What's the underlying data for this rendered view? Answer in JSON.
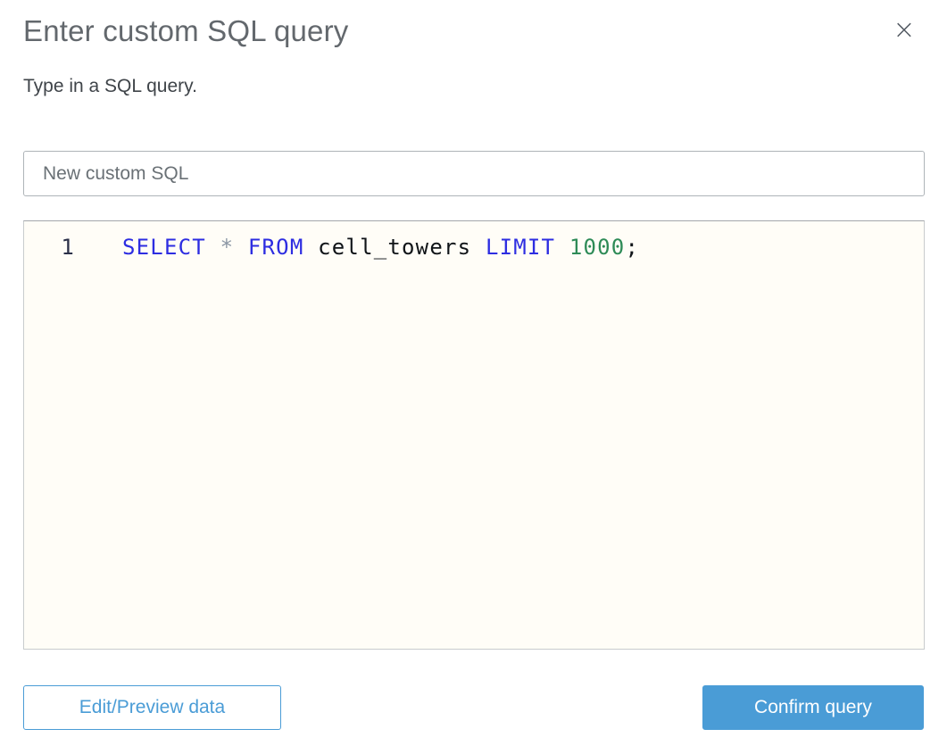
{
  "dialog": {
    "title": "Enter custom SQL query",
    "subtitle": "Type in a SQL query.",
    "close_icon": "×"
  },
  "name_input": {
    "value": "New custom SQL"
  },
  "editor": {
    "lines": [
      {
        "number": "1",
        "raw": "SELECT * FROM cell_towers LIMIT 1000;",
        "tokens": [
          {
            "text": "SELECT",
            "type": "keyword"
          },
          {
            "text": " ",
            "type": "plain"
          },
          {
            "text": "*",
            "type": "operator"
          },
          {
            "text": " ",
            "type": "plain"
          },
          {
            "text": "FROM",
            "type": "keyword"
          },
          {
            "text": " cell_towers ",
            "type": "plain"
          },
          {
            "text": "LIMIT",
            "type": "keyword"
          },
          {
            "text": " ",
            "type": "plain"
          },
          {
            "text": "1000",
            "type": "number"
          },
          {
            "text": ";",
            "type": "plain"
          }
        ]
      }
    ]
  },
  "footer": {
    "edit_preview_label": "Edit/Preview data",
    "confirm_label": "Confirm query"
  },
  "colors": {
    "accent_blue": "#4a9cd6",
    "keyword_blue": "#2d2de1",
    "number_green": "#2e8b57",
    "operator_gray": "#8b96a4",
    "editor_bg": "#fffdf7",
    "title_gray": "#63686d",
    "body_gray": "#3f4449"
  }
}
